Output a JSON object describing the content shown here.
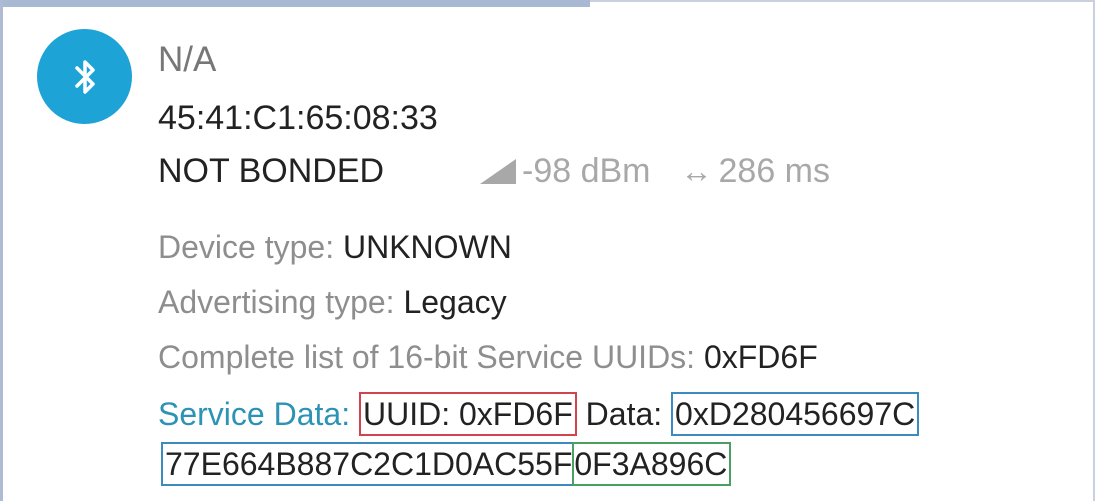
{
  "device": {
    "name": "N/A",
    "mac": "45:41:C1:65:08:33",
    "bond_state": "NOT BONDED",
    "rssi": "-98 dBm",
    "interval": "286 ms",
    "icon": "bluetooth-icon",
    "accent_color": "#1ea3d6"
  },
  "details": {
    "device_type_label": "Device type: ",
    "device_type_value": "UNKNOWN",
    "adv_type_label": "Advertising type: ",
    "adv_type_value": "Legacy",
    "uuid_list_label": "Complete list of 16-bit Service UUIDs: ",
    "uuid_list_value": "0xFD6F",
    "service_data_label": "Service Data:",
    "service_uuid": "UUID: 0xFD6F",
    "data_label": "Data:",
    "data_part1": "0xD280456697C",
    "data_part2": "77E664B887C2C1D0AC55F",
    "data_part3": "0F3A896C"
  },
  "highlight_colors": {
    "uuid": "#d0444f",
    "data": "#3b8bbf",
    "tail": "#4aa062"
  }
}
